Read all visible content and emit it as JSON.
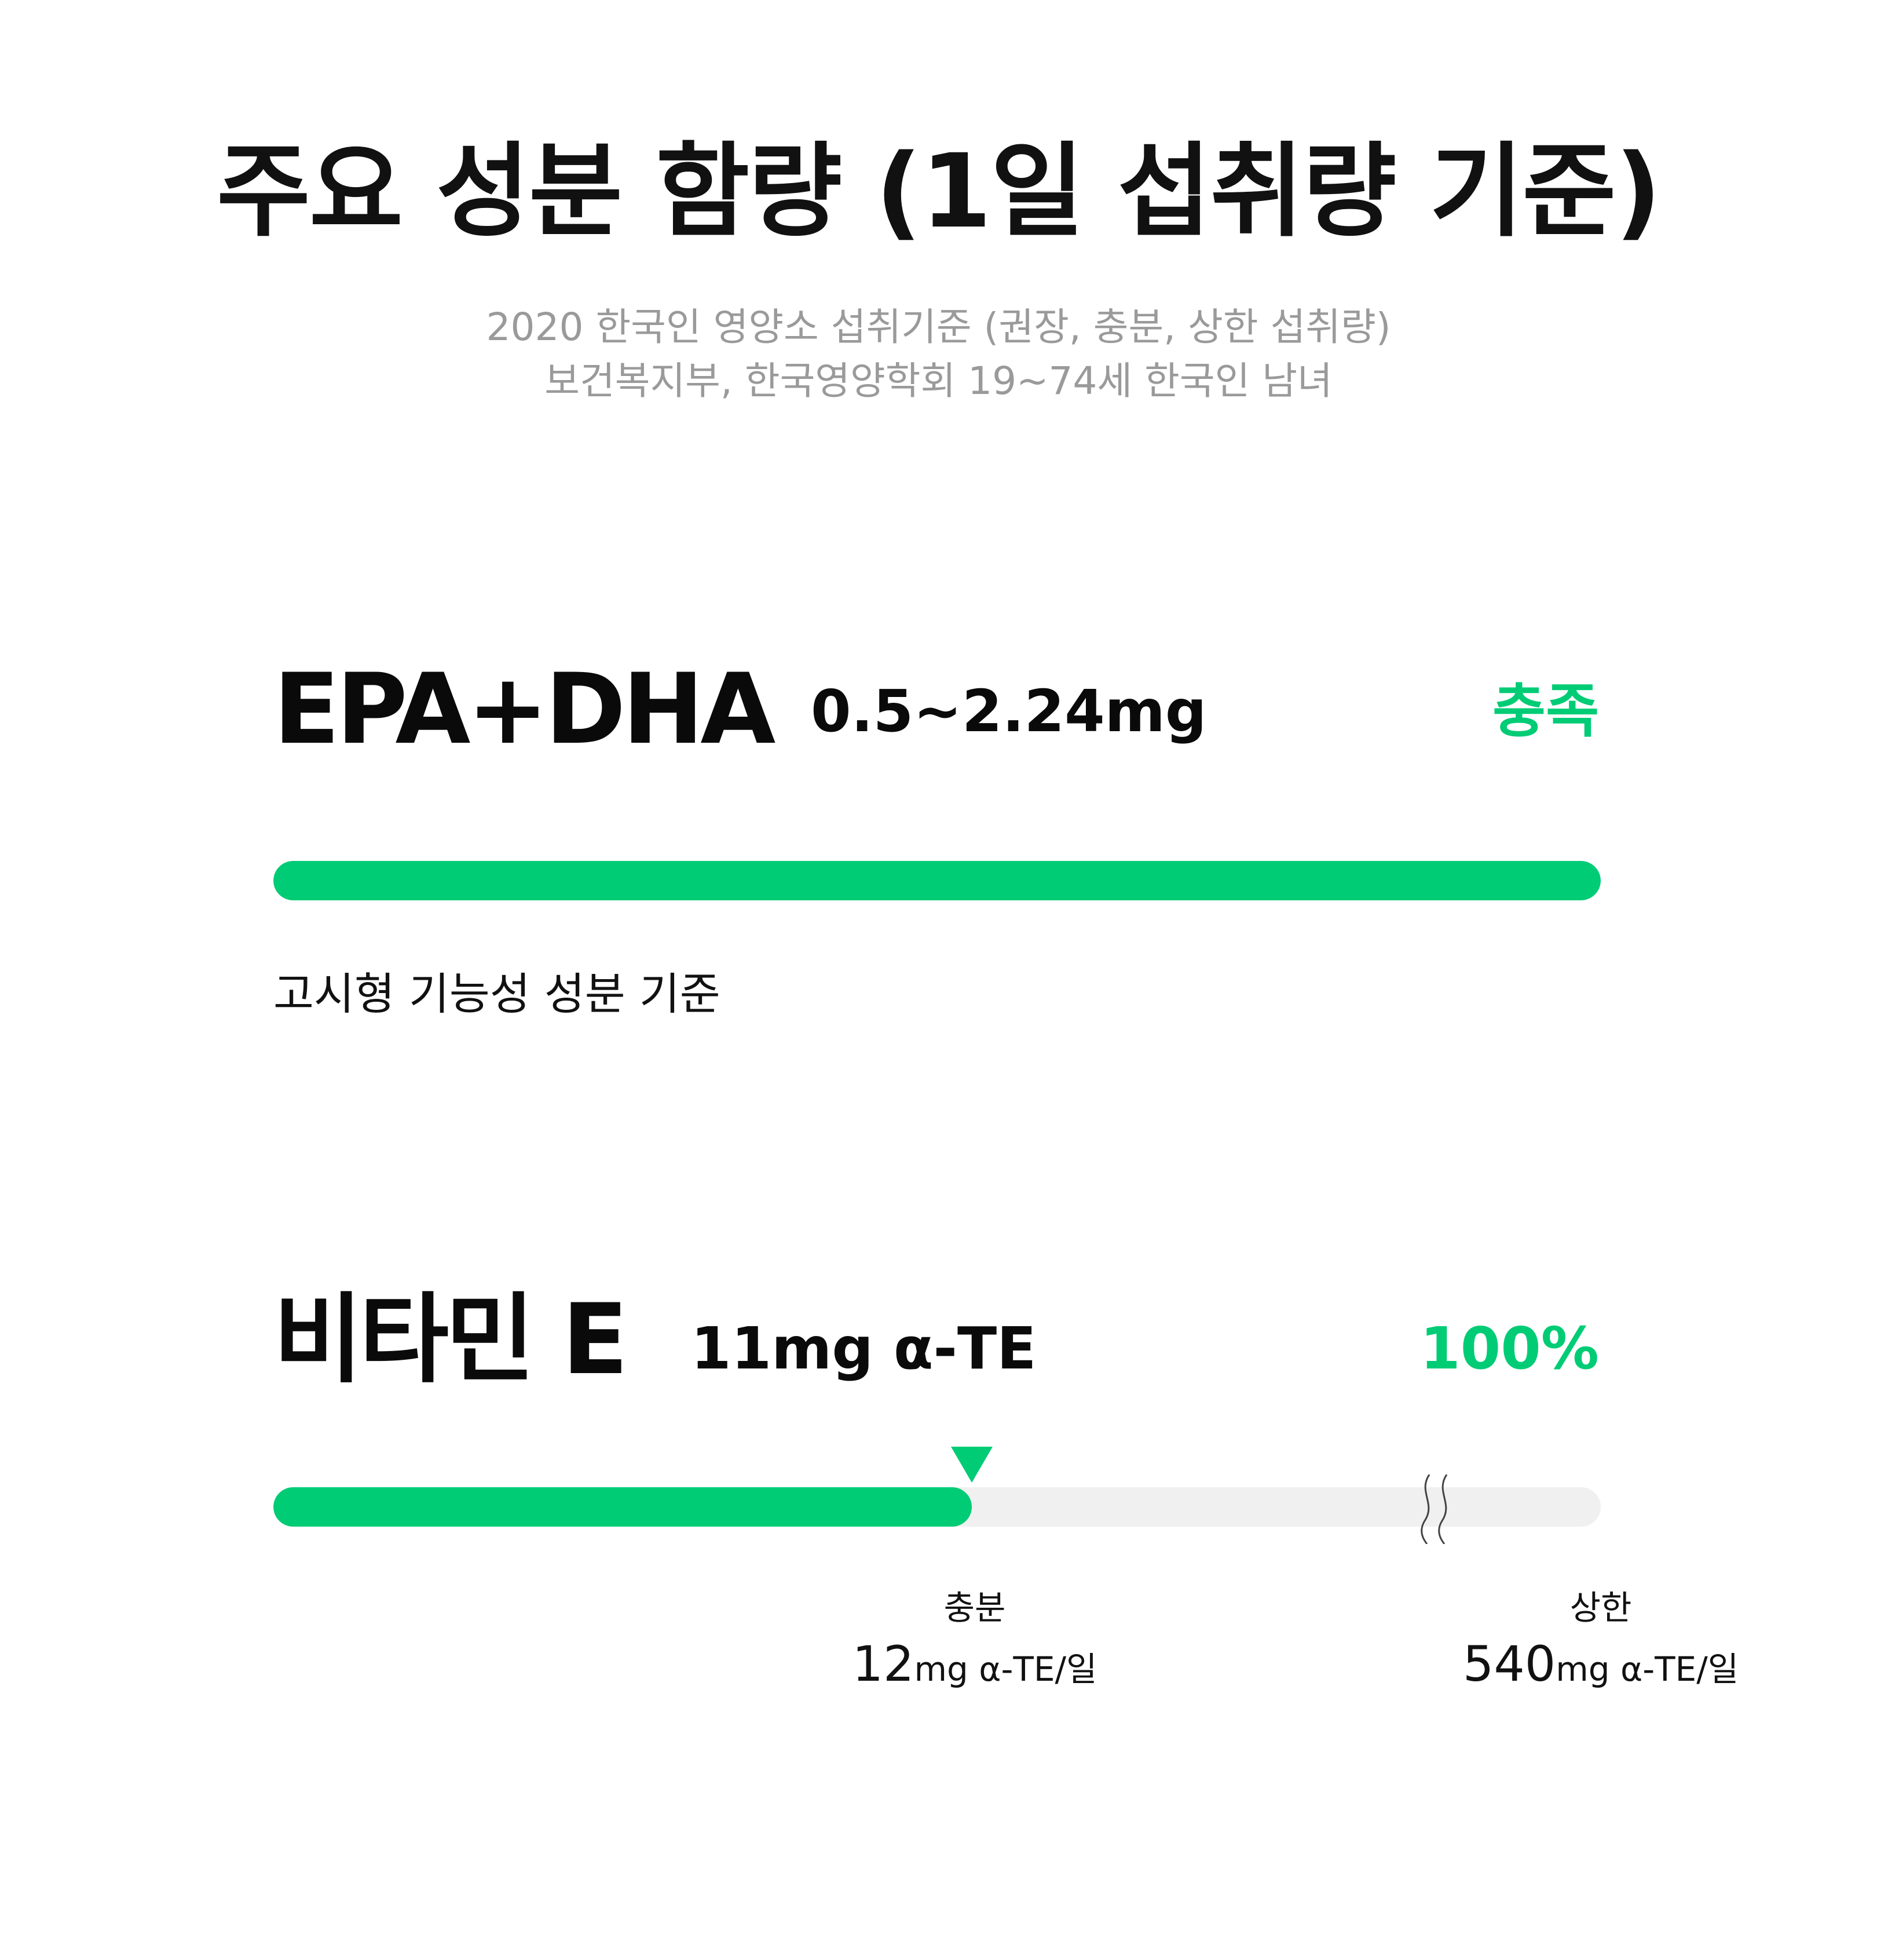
{
  "header": {
    "title": "주요 성분 함량 (1일 섭취량 기준)",
    "subtitle_line1": "2020 한국인 영양소 섭취기준 (권장, 충분, 상한 섭취량)",
    "subtitle_line2": "보건복지부, 한국영양학회  19~74세 한국인 남녀"
  },
  "colors": {
    "accent": "#00cc76",
    "track": "#f0f0f0",
    "text": "#0a0a0a",
    "muted": "#9a9a9a"
  },
  "nutrients": [
    {
      "name": "EPA+DHA",
      "amount": "0.5~2.24mg",
      "status": "충족",
      "fill_fraction": 1.0,
      "note": "고시형 기능성 성분 기준"
    },
    {
      "name": "비타민 E",
      "amount": "11mg α-TE",
      "status": "100%",
      "fill_fraction": 0.526,
      "marker_icon": "triangle-down-icon",
      "break_icon": "axis-break-icon",
      "labels": [
        {
          "title": "충분",
          "value": "12",
          "unit": "mg α-TE/일"
        },
        {
          "title": "상한",
          "value": "540",
          "unit": "mg α-TE/일"
        }
      ]
    }
  ]
}
